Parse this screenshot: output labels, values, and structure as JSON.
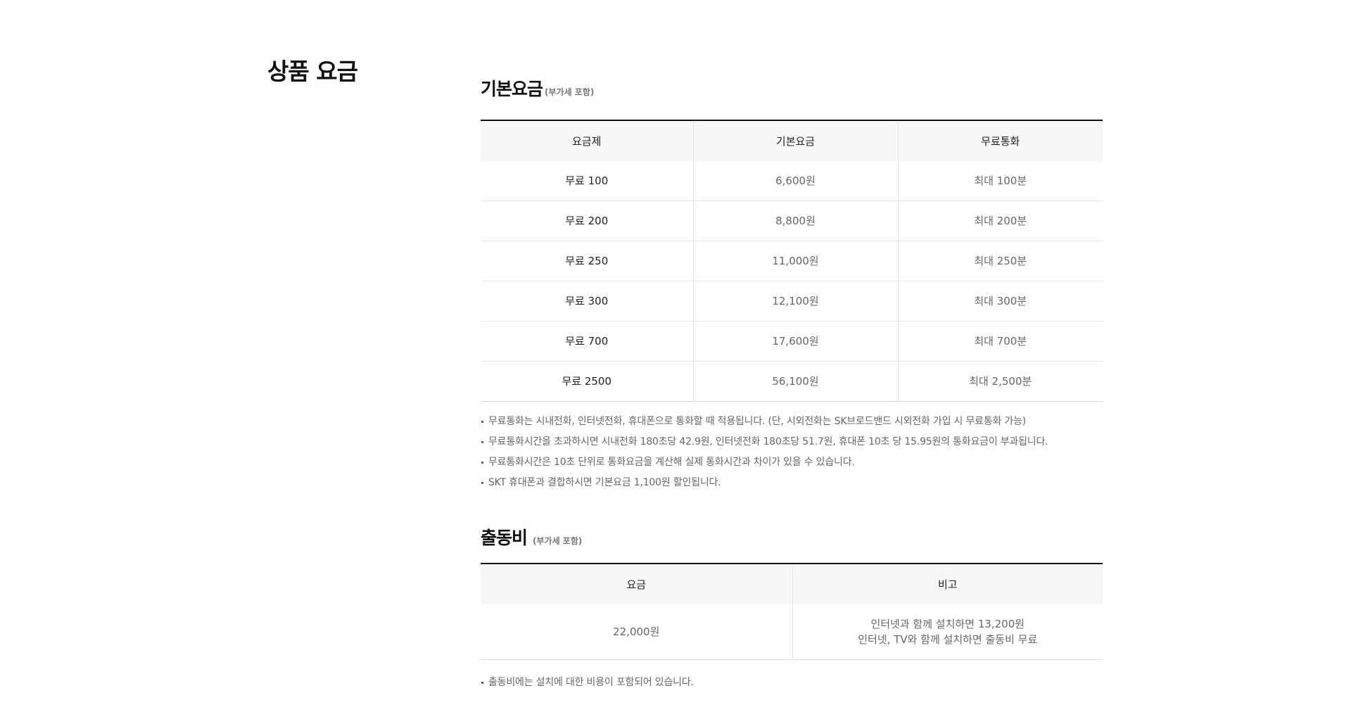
{
  "page_title": "상품 요금",
  "basic_fee": {
    "title": "기본요금",
    "subtitle": "(부가세 포함)",
    "headers": [
      "요금제",
      "기본요금",
      "무료통화"
    ],
    "rows": [
      [
        "무료 100",
        "6,600원",
        "최대 100분"
      ],
      [
        "무료 200",
        "8,800원",
        "최대 200분"
      ],
      [
        "무료 250",
        "11,000원",
        "최대 250분"
      ],
      [
        "무료 300",
        "12,100원",
        "최대 300분"
      ],
      [
        "무료 700",
        "17,600원",
        "최대 700분"
      ],
      [
        "무료 2500",
        "56,100원",
        "최대 2,500분"
      ]
    ],
    "notes": [
      "무료통화는 시내전화, 인터넷전화, 휴대폰으로 통화할 때 적용됩니다. (단, 시외전화는 SK브로드밴드 시외전화 가입 시 무료통화 가능)",
      "무료통화시간을 초과하시면 시내전화 180초당 42.9원, 인터넷전화 180초당 51.7원, 휴대폰 10초 당 15.95원의 통화요금이 부과됩니다.",
      "무료통화시간은 10초 단위로 통화요금을 계산해 실제 통화시간과 차이가 있을 수 있습니다.",
      "SKT 휴대폰과 결합하시면 기본요금 1,100원 할인됩니다."
    ]
  },
  "visit_fee": {
    "title": "출동비",
    "subtitle": "(부가세 포함)",
    "headers": [
      "요금",
      "비고"
    ],
    "rows": [
      {
        "fee": "22,000원",
        "remark_line1": "인터넷과 함께 설치하면 13,200원",
        "remark_line2": "인터넷, TV와 함께 설치하면 출동비 무료"
      }
    ],
    "notes": [
      "출동비에는 설치에 대한 비용이 포함되어 있습니다."
    ]
  }
}
